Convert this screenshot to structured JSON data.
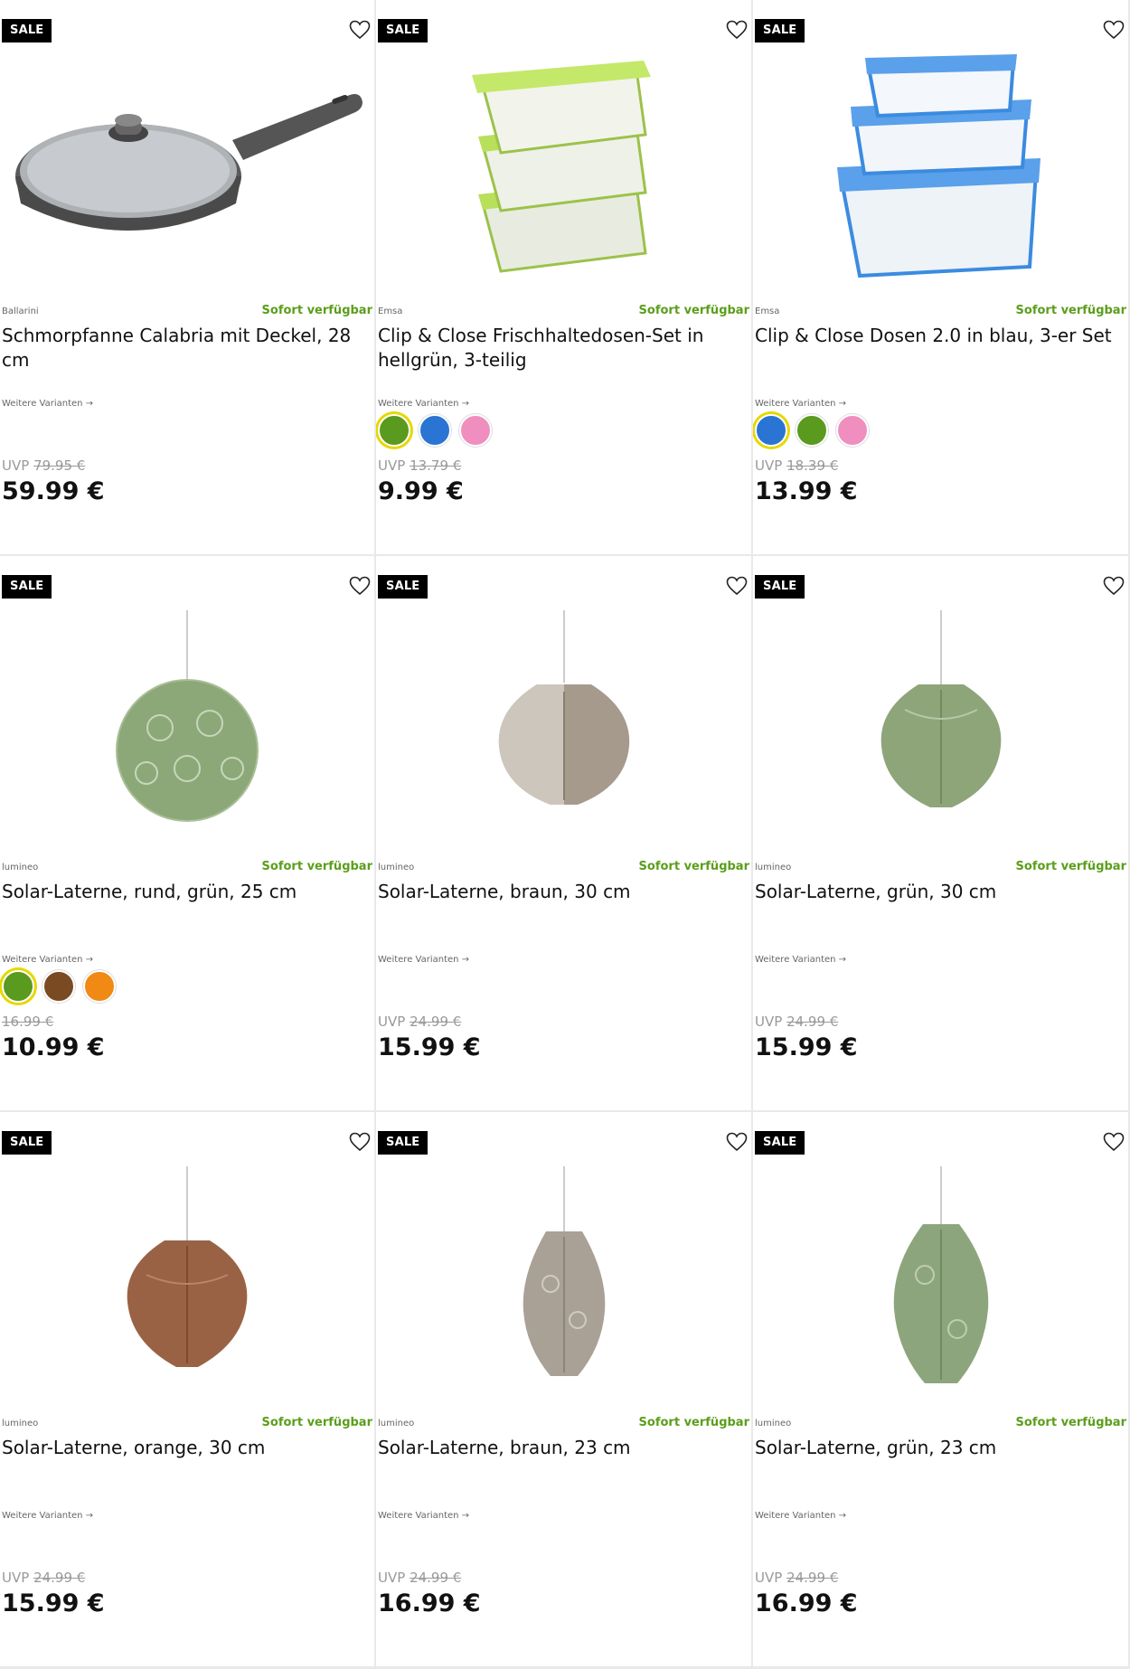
{
  "badge_label": "SALE",
  "availability_label": "Sofort verfügbar",
  "variants_label": "Weitere Varianten →",
  "uvp_label": "UVP",
  "products": [
    {
      "brand": "Ballarini",
      "title": "Schmorpfanne Calabria mit Deckel, 28 cm",
      "old_price": "79.95 €",
      "price": "59.99 €",
      "image": "pan-icon",
      "swatches": []
    },
    {
      "brand": "Emsa",
      "title": "Clip & Close Frischhaltedosen-Set in hellgrün, 3-teilig",
      "old_price": "13.79 €",
      "price": "9.99 €",
      "image": "green-container-icon",
      "swatches": [
        "#5a9a1e",
        "#2a74d4",
        "#f08ec0"
      ]
    },
    {
      "brand": "Emsa",
      "title": "Clip & Close Dosen 2.0 in blau, 3-er Set",
      "old_price": "18.39 €",
      "price": "13.99 €",
      "image": "blue-container-icon",
      "swatches": [
        "#2a74d4",
        "#5a9a1e",
        "#f08ec0"
      ]
    },
    {
      "brand": "lumineo",
      "title": "Solar-Laterne, rund, grün, 25 cm",
      "old_price": "16.99 €",
      "price": "10.99 €",
      "image": "lantern-round-green-icon",
      "swatches": [
        "#5a9a1e",
        "#7a4a22",
        "#f08a14"
      ],
      "no_uvp": true
    },
    {
      "brand": "lumineo",
      "title": "Solar-Laterne, braun, 30 cm",
      "old_price": "24.99 €",
      "price": "15.99 €",
      "image": "lantern-brown-icon",
      "swatches": []
    },
    {
      "brand": "lumineo",
      "title": "Solar-Laterne, grün, 30 cm",
      "old_price": "24.99 €",
      "price": "15.99 €",
      "image": "lantern-green-icon",
      "swatches": []
    },
    {
      "brand": "lumineo",
      "title": "Solar-Laterne, orange, 30 cm",
      "old_price": "24.99 €",
      "price": "15.99 €",
      "image": "lantern-orange-icon",
      "swatches": []
    },
    {
      "brand": "lumineo",
      "title": "Solar-Laterne, braun, 23 cm",
      "old_price": "24.99 €",
      "price": "16.99 €",
      "image": "lantern-oval-brown-icon",
      "swatches": []
    },
    {
      "brand": "lumineo",
      "title": "Solar-Laterne, grün, 23 cm",
      "old_price": "24.99 €",
      "price": "16.99 €",
      "image": "lantern-oval-green-icon",
      "swatches": []
    }
  ]
}
